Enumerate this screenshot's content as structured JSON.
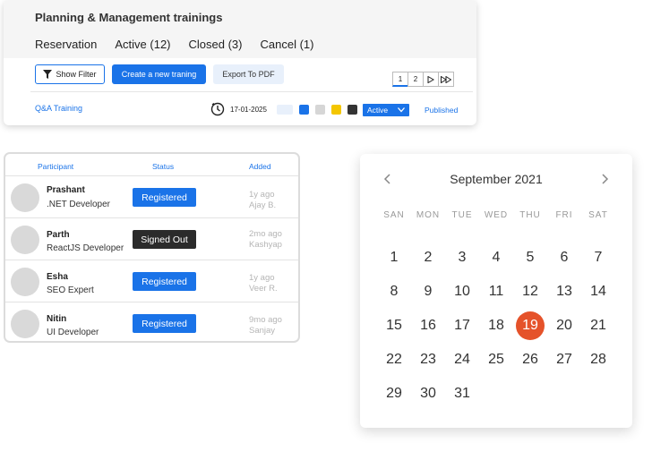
{
  "trainings": {
    "title": "Planning & Management trainings",
    "tabs": [
      "Reservation",
      "Active (12)",
      "Closed (3)",
      "Cancel (1)"
    ],
    "toolbar": {
      "show_filter": "Show Filter",
      "create": "Create a new traning",
      "export": "Export To PDF"
    },
    "pager": {
      "pages": [
        "1",
        "2"
      ]
    },
    "row": {
      "name": "Q&A Training",
      "date": "17-01-2025",
      "status_select": "Active",
      "published": "Published"
    },
    "colors": {
      "accent": "#1a73e8",
      "swatches": [
        "#e8f0fb",
        "#1a73e8",
        "#d6d6d6",
        "#f4c600",
        "#333333"
      ]
    }
  },
  "participants": {
    "headers": {
      "participant": "Participant",
      "status": "Status",
      "added": "Added"
    },
    "rows": [
      {
        "name": "Prashant",
        "role": ".NET Developer",
        "status": "Registered",
        "time": "1y ago",
        "by": "Ajay B."
      },
      {
        "name": "Parth",
        "role": "ReactJS Developer",
        "status": "Signed Out",
        "time": "2mo ago",
        "by": "Kashyap"
      },
      {
        "name": "Esha",
        "role": "SEO Expert",
        "status": "Registered",
        "time": "1y ago",
        "by": "Veer R."
      },
      {
        "name": "Nitin",
        "role": "UI Developer",
        "status": "Registered",
        "time": "9mo ago",
        "by": "Sanjay"
      }
    ]
  },
  "calendar": {
    "month": "September 2021",
    "weekdays": [
      "SAN",
      "MON",
      "TUE",
      "WED",
      "THU",
      "FRI",
      "SAT"
    ],
    "weeks": [
      [
        "1",
        "2",
        "3",
        "4",
        "5",
        "6",
        "7"
      ],
      [
        "8",
        "9",
        "10",
        "11",
        "12",
        "13",
        "14"
      ],
      [
        "15",
        "16",
        "17",
        "18",
        "19",
        "20",
        "21"
      ],
      [
        "22",
        "23",
        "24",
        "25",
        "26",
        "27",
        "28"
      ],
      [
        "29",
        "30",
        "31"
      ]
    ],
    "selected": "19",
    "selected_color": "#e5522a"
  }
}
